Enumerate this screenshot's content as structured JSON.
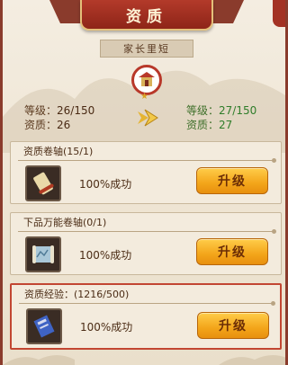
{
  "title": "资质",
  "character": {
    "name": "家长里短"
  },
  "current": {
    "level_label": "等级：",
    "level_value": "26/150",
    "aptitude_label": "资质：",
    "aptitude_value": "26"
  },
  "next": {
    "level_label": "等级：",
    "level_value": "27/150",
    "aptitude_label": "资质：",
    "aptitude_value": "27"
  },
  "items": [
    {
      "header": "资质卷轴(15/1)",
      "rate": "100%成功",
      "button": "升级",
      "icon": "scroll-icon"
    },
    {
      "header": "下品万能卷轴(0/1)",
      "rate": "100%成功",
      "button": "升级",
      "icon": "map-scroll-icon"
    },
    {
      "header": "资质经验：(1216/500)",
      "rate": "100%成功",
      "button": "升级",
      "icon": "book-icon"
    }
  ],
  "colors": {
    "frame": "#8a3b2c",
    "title_bg": "#b33a2a",
    "button": "#f3a51a",
    "next_value": "#2f7d2a"
  }
}
